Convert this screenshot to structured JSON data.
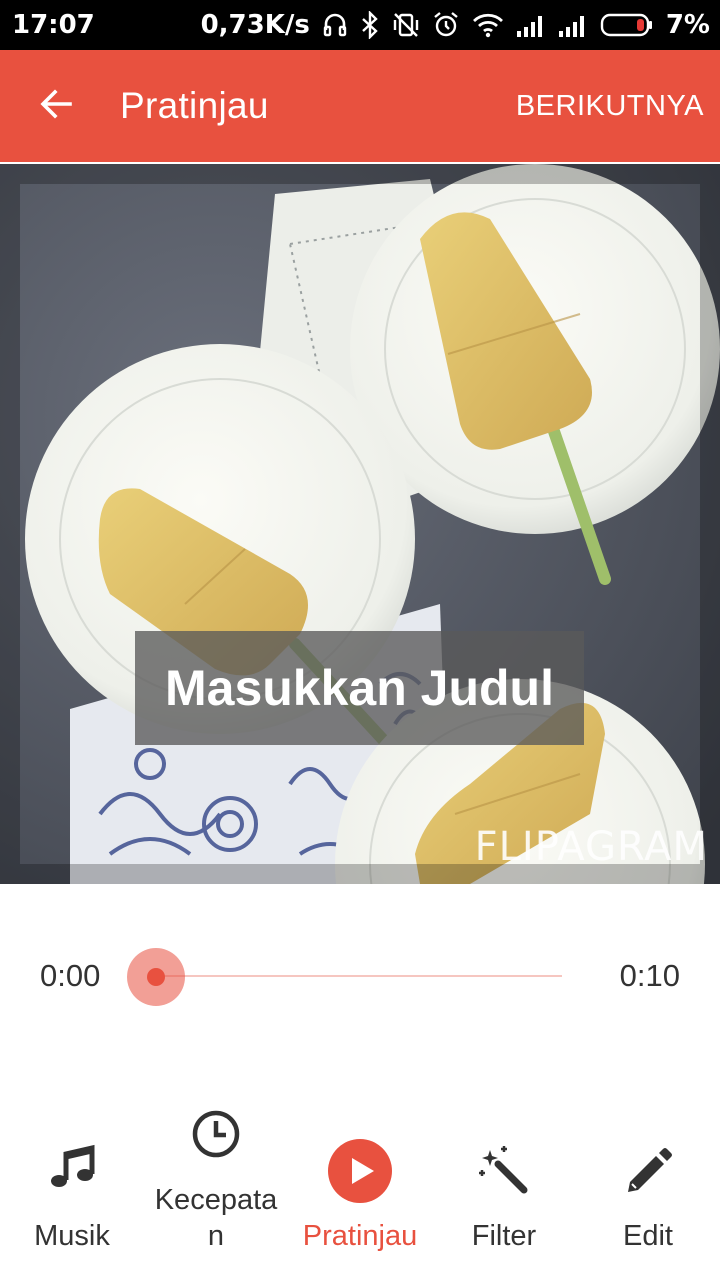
{
  "status_bar": {
    "time": "17:07",
    "network_speed": "0,73K/s",
    "battery_percent": "7%",
    "icons": [
      "headset-icon",
      "bluetooth-icon",
      "vibrate-off-icon",
      "alarm-icon",
      "wifi-icon",
      "signal-icon",
      "signal-icon",
      "battery-icon"
    ]
  },
  "toolbar": {
    "title": "Pratinjau",
    "next_label": "BERIKUTNYA",
    "back_icon": "arrow-back-icon",
    "color": "#e8513f"
  },
  "preview": {
    "title_placeholder": "Masukkan Judul",
    "watermark": "FLIPAGRAM"
  },
  "playback": {
    "current_time": "0:00",
    "duration": "0:10",
    "progress": 0
  },
  "bottom_nav": {
    "items": [
      {
        "label": "Musik",
        "icon": "music-note-icon",
        "active": false
      },
      {
        "label": "Kecepata\nn",
        "icon": "clock-icon",
        "active": false
      },
      {
        "label": "Pratinjau",
        "icon": "play-circle-icon",
        "active": true
      },
      {
        "label": "Filter",
        "icon": "magic-wand-icon",
        "active": false
      },
      {
        "label": "Edit",
        "icon": "pencil-icon",
        "active": false
      }
    ],
    "active_color": "#e8513f"
  }
}
